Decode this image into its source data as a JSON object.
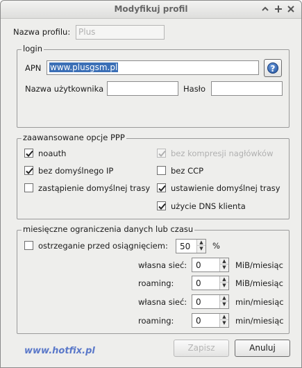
{
  "window": {
    "title": "Modyfikuj profil",
    "controls": [
      "+",
      "+",
      "×"
    ]
  },
  "profile": {
    "label": "Nazwa profilu:",
    "value": "Plus"
  },
  "login": {
    "legend": "login",
    "apn_label": "APN",
    "apn_value": "www.plusgsm.pl",
    "user_label": "Nazwa użytkownika",
    "user_value": "",
    "pass_label": "Hasło",
    "pass_value": "",
    "help_glyph": "?"
  },
  "ppp": {
    "legend": "zaawansowane opcje PPP",
    "options": [
      {
        "label": "noauth",
        "checked": true,
        "enabled": true
      },
      {
        "label": "bez kompresji nagłówków",
        "checked": true,
        "enabled": false
      },
      {
        "label": "bez domyślnego IP",
        "checked": true,
        "enabled": true
      },
      {
        "label": "bez CCP",
        "checked": false,
        "enabled": true
      },
      {
        "label": "zastąpienie domyślnej trasy",
        "checked": false,
        "enabled": true
      },
      {
        "label": "ustawienie domyślnej trasy",
        "checked": true,
        "enabled": true
      },
      {
        "label": "użycie DNS klienta",
        "checked": true,
        "enabled": true
      }
    ]
  },
  "limits": {
    "legend": "miesięczne ograniczenia danych lub czasu",
    "warn_label": "ostrzeganie przed osiągnięciem:",
    "warn_checked": false,
    "warn_value": "50",
    "warn_unit": "%",
    "rows": [
      {
        "label": "własna sieć:",
        "value": "0",
        "unit": "MiB/miesiąc"
      },
      {
        "label": "roaming:",
        "value": "0",
        "unit": "MiB/miesiąc"
      },
      {
        "label": "własna sieć:",
        "value": "0",
        "unit": "min/miesiąc"
      },
      {
        "label": "roaming:",
        "value": "0",
        "unit": "min/miesiąc"
      }
    ]
  },
  "footer": {
    "brand": "www.hotfix.pl",
    "save_label": "Zapisz",
    "cancel_label": "Anuluj"
  }
}
